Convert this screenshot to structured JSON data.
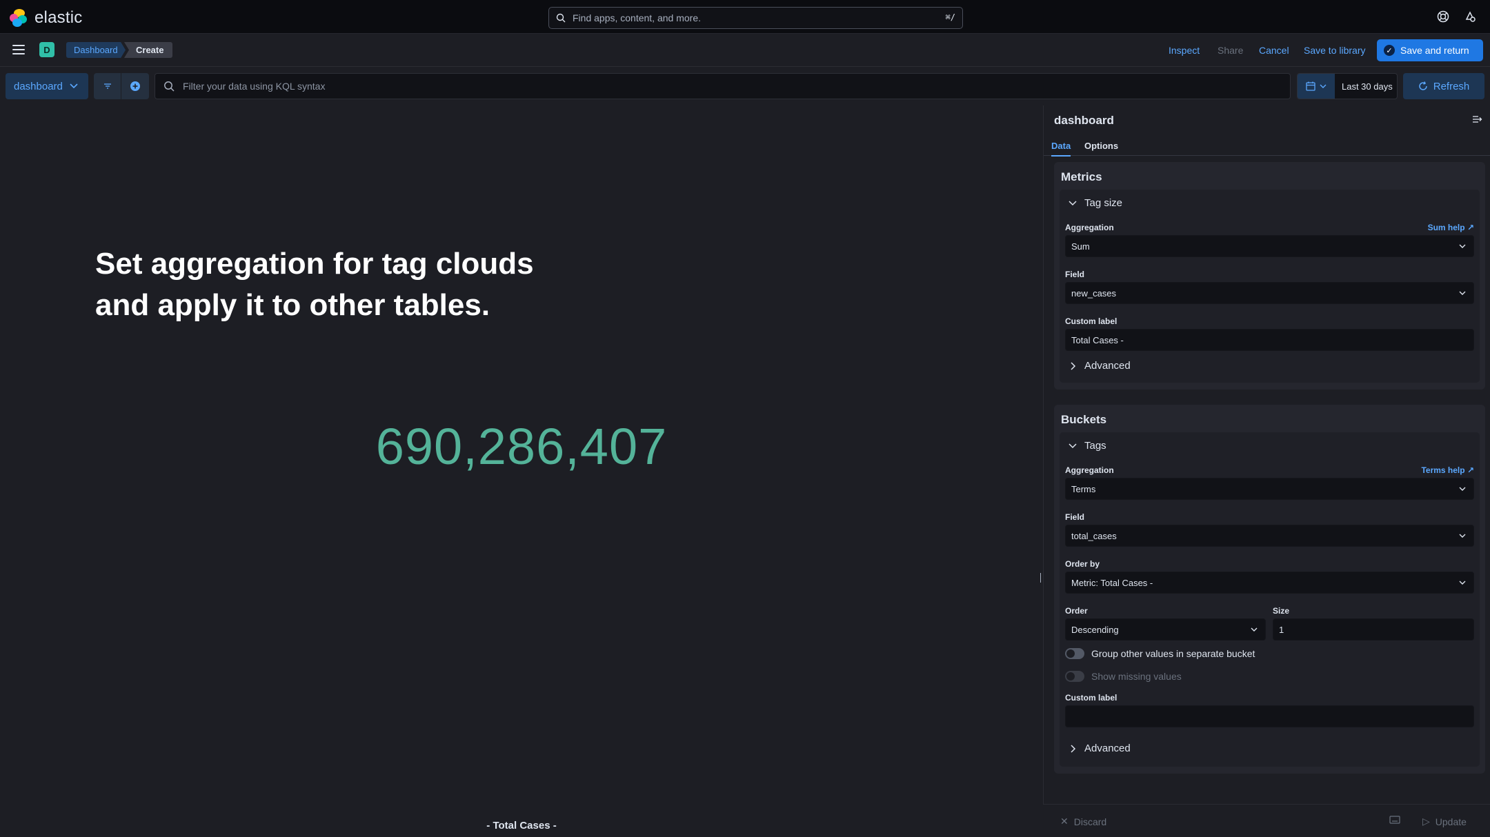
{
  "topbar": {
    "brand": "elastic",
    "search_placeholder": "Find apps, content, and more.",
    "search_shortcut": "⌘/"
  },
  "navbar": {
    "space_initial": "D",
    "breadcrumbs": [
      "Dashboard",
      "Create"
    ],
    "actions": {
      "inspect": "Inspect",
      "share": "Share",
      "cancel": "Cancel",
      "save_to_library": "Save to library",
      "save_and_return": "Save and return"
    }
  },
  "querybar": {
    "data_view": "dashboard",
    "kql_placeholder": "Filter your data using KQL syntax",
    "date_range": "Last 30 days",
    "refresh": "Refresh"
  },
  "visualization": {
    "overlay_line1": "Set aggregation for tag clouds",
    "overlay_line2": "and apply it to other tables.",
    "metric_value": "690,286,407",
    "metric_label": "- Total Cases -",
    "metric_color": "#54b399"
  },
  "sidebar": {
    "title": "dashboard",
    "tabs": [
      "Data",
      "Options"
    ],
    "metrics": {
      "title": "Metrics",
      "accordion_title": "Tag size",
      "aggregation_label": "Aggregation",
      "aggregation_help": "Sum help",
      "aggregation_value": "Sum",
      "field_label": "Field",
      "field_value": "new_cases",
      "custom_label_label": "Custom label",
      "custom_label_value": "Total Cases -",
      "advanced": "Advanced"
    },
    "buckets": {
      "title": "Buckets",
      "accordion_title": "Tags",
      "aggregation_label": "Aggregation",
      "aggregation_help": "Terms help",
      "aggregation_value": "Terms",
      "field_label": "Field",
      "field_value": "total_cases",
      "order_by_label": "Order by",
      "order_by_value": "Metric: Total Cases -",
      "order_label": "Order",
      "order_value": "Descending",
      "size_label": "Size",
      "size_value": "1",
      "group_other": "Group other values in separate bucket",
      "show_missing": "Show missing values",
      "custom_label_label": "Custom label",
      "custom_label_value": "",
      "advanced": "Advanced"
    },
    "footer": {
      "discard": "Discard",
      "update": "Update"
    }
  },
  "colors": {
    "accent": "#5ba8ff",
    "primary_button": "#1f78e3",
    "background": "#1d1e24"
  }
}
